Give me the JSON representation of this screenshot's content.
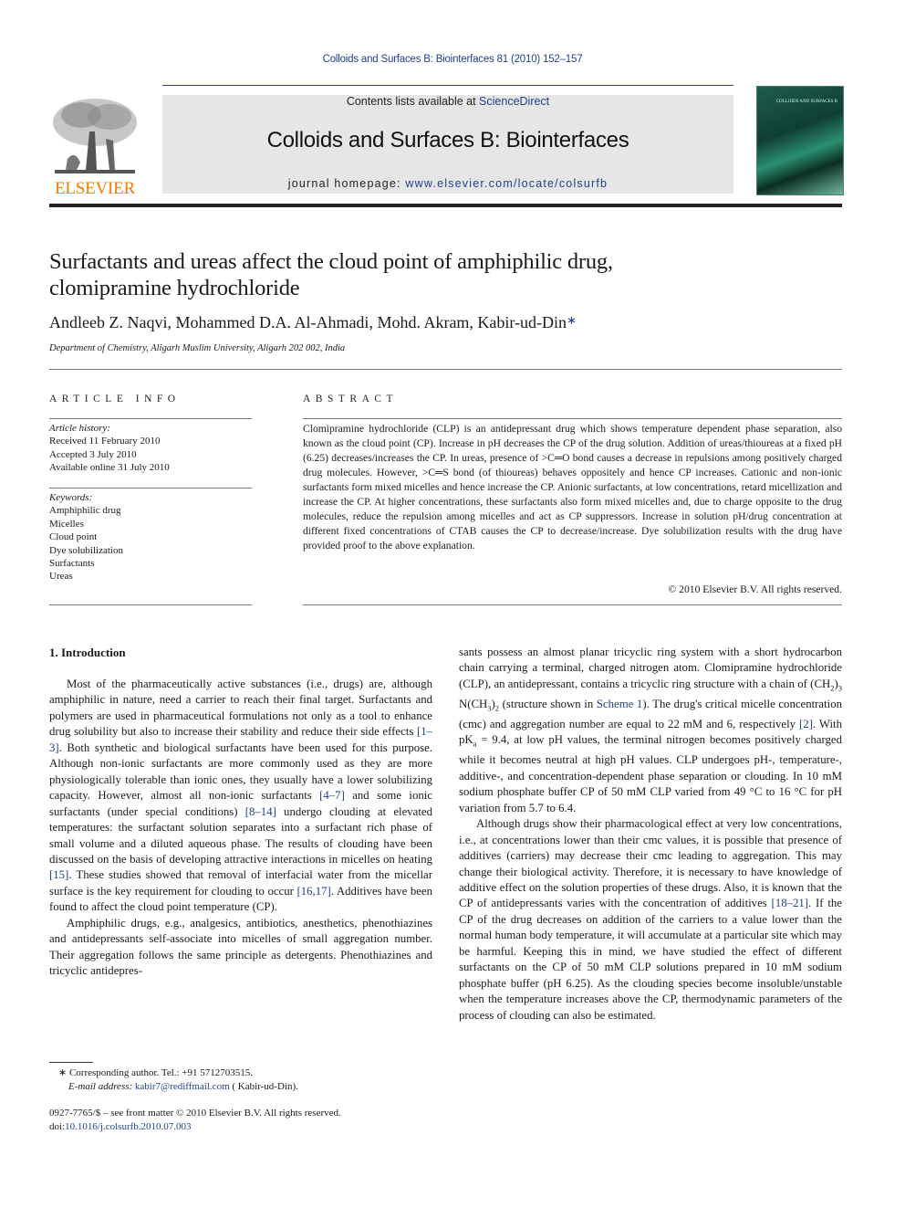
{
  "header": {
    "citation": "Colloids and Surfaces B: Biointerfaces 81 (2010) 152–157",
    "contents_prefix": "Contents lists available at ",
    "contents_link": "ScienceDirect",
    "journal_title": "Colloids and Surfaces B: Biointerfaces",
    "homepage_prefix": "journal homepage: ",
    "homepage_link": "www.elsevier.com/locate/colsurfb",
    "publisher_logo_text": "ELSEVIER",
    "cover_title": "COLLOIDS AND SURFACES B",
    "colors": {
      "publisher_orange": "#f07d00",
      "link_blue": "#1f3f8f",
      "banner_gray": "#e6e6e6"
    }
  },
  "article": {
    "title_line1": "Surfactants and ureas affect the cloud point of amphiphilic drug,",
    "title_line2": "clomipramine hydrochloride",
    "authors": "Andleeb Z. Naqvi, Mohammed D.A. Al-Ahmadi, Mohd. Akram, Kabir-ud-Din",
    "corresponding_mark": "∗",
    "affiliation": "Department of Chemistry, Aligarh Muslim University, Aligarh 202 002, India"
  },
  "article_info": {
    "heading": "ARTICLE INFO",
    "history_label": "Article history:",
    "history": [
      "Received 11 February 2010",
      "Accepted 3 July 2010",
      "Available online 31 July 2010"
    ],
    "keywords_label": "Keywords:",
    "keywords": [
      "Amphiphilic drug",
      "Micelles",
      "Cloud point",
      "Dye solubilization",
      "Surfactants",
      "Ureas"
    ]
  },
  "abstract": {
    "heading": "ABSTRACT",
    "text": "Clomipramine hydrochloride (CLP) is an antidepressant drug which shows temperature dependent phase separation, also known as the cloud point (CP). Increase in pH decreases the CP of the drug solution. Addition of ureas/thioureas at a fixed pH (6.25) decreases/increases the CP. In ureas, presence of >C═O bond causes a decrease in repulsions among positively charged drug molecules. However, >C═S bond (of thioureas) behaves oppositely and hence CP increases. Cationic and non-ionic surfactants form mixed micelles and hence increase the CP. Anionic surfactants, at low concentrations, retard micellization and increase the CP. At higher concentrations, these surfactants also form mixed micelles and, due to charge opposite to the drug molecules, reduce the repulsion among micelles and act as CP suppressors. Increase in solution pH/drug concentration at different fixed concentrations of CTAB causes the CP to decrease/increase. Dye solubilization results with the drug have provided proof to the above explanation.",
    "copyright": "© 2010 Elsevier B.V. All rights reserved."
  },
  "body": {
    "section_heading": "1.  Introduction",
    "left": {
      "p1_a": "Most of the pharmaceutically active substances (i.e., drugs) are, although amphiphilic in nature, need a carrier to reach their final target. Surfactants and polymers are used in pharmaceutical formulations not only as a tool to enhance drug solubility but also to increase their stability and reduce their side effects ",
      "ref1": "[1–3]",
      "p1_b": ". Both synthetic and biological surfactants have been used for this purpose. Although non-ionic surfactants are more commonly used as they are more physiologically tolerable than ionic ones, they usually have a lower solubilizing capacity. However, almost all non-ionic surfactants ",
      "ref2": "[4–7]",
      "p1_c": " and some ionic surfactants (under special conditions) ",
      "ref3": "[8–14]",
      "p1_d": " undergo clouding at elevated temperatures: the surfactant solution separates into a surfactant rich phase of small volume and a diluted aqueous phase. The results of clouding have been discussed on the basis of developing attractive interactions in micelles on heating ",
      "ref4": "[15]",
      "p1_e": ". These studies showed that removal of interfacial water from the micellar surface is the key requirement for clouding to occur ",
      "ref5": "[16,17]",
      "p1_f": ". Additives have been found to affect the cloud point temperature (CP).",
      "p2": "Amphiphilic drugs, e.g., analgesics, antibiotics, anesthetics, phenothiazines and antidepressants self-associate into micelles of small aggregation number. Their aggregation follows the same principle as detergents. Phenothiazines and tricyclic antidepres-"
    },
    "right": {
      "p1_a": "sants possess an almost planar tricyclic ring system with a short hydrocarbon chain carrying a terminal, charged nitrogen atom. Clomipramine hydrochloride (CLP), an antidepressant, contains a tricyclic ring structure with a chain of (CH",
      "sub1": "2",
      "p1_a2": ")",
      "sub2": "3",
      "p1_a3": " N(CH",
      "sub3": "3",
      "p1_a4": ")",
      "sub4": "2",
      "p1_b": " (structure shown in ",
      "scheme_ref": "Scheme 1",
      "p1_c": "). The drug's critical micelle concentration (cmc) and aggregation number are equal to 22 mM and 6, respectively ",
      "ref1": "[2]",
      "p1_d": ". With pK",
      "sub5": "a",
      "p1_e": " = 9.4, at low pH values, the terminal nitrogen becomes positively charged while it becomes neutral at high pH values. CLP undergoes pH-, temperature-, additive-, and concentration-dependent phase separation or clouding. In 10 mM sodium phosphate buffer CP of 50 mM CLP varied from 49 °C to 16 °C for pH variation from 5.7 to 6.4.",
      "p2_a": "Although drugs show their pharmacological effect at very low concentrations, i.e., at concentrations lower than their cmc values, it is possible that presence of additives (carriers) may decrease their cmc leading to aggregation. This may change their biological activity. Therefore, it is necessary to have knowledge of additive effect on the solution properties of these drugs. Also, it is known that the CP of antidepressants varies with the concentration of additives ",
      "ref2": "[18–21]",
      "p2_b": ". If the CP of the drug decreases on addition of the carriers to a value lower than the normal human body temperature, it will accumulate at a particular site which may be harmful. Keeping this in mind, we have studied the effect of different surfactants on the CP of 50 mM CLP solutions prepared in 10 mM sodium phosphate buffer (pH 6.25). As the clouding species become insoluble/unstable when the temperature increases above the CP, thermodynamic parameters of the process of clouding can also be estimated."
    }
  },
  "footnote": {
    "mark": "∗",
    "corresponding": "Corresponding author. Tel.: +91 5712703515.",
    "email_label": "E-mail address: ",
    "email": "kabir7@rediffmail.com",
    "email_suffix": " ( Kabir-ud-Din).",
    "front_matter": "0927-7765/$ – see front matter © 2010 Elsevier B.V. All rights reserved.",
    "doi_label": "doi:",
    "doi": "10.1016/j.colsurfb.2010.07.003"
  }
}
